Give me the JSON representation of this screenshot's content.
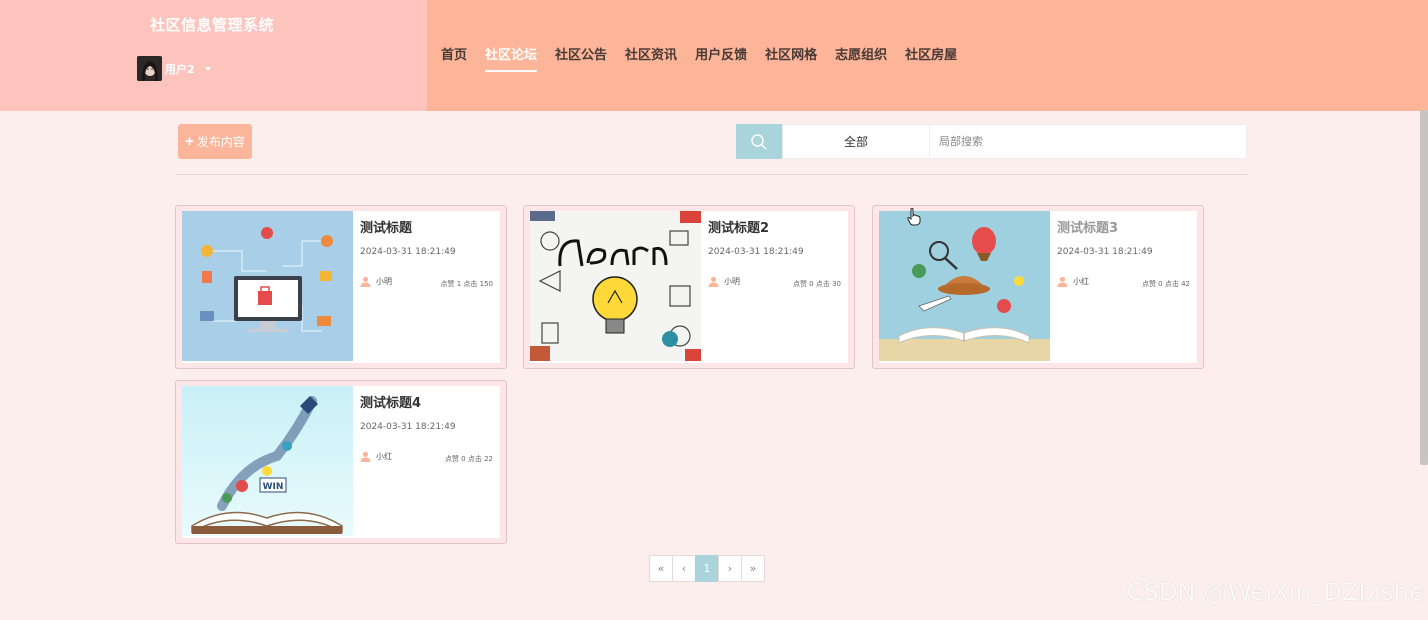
{
  "app": {
    "title": "社区信息管理系统"
  },
  "user": {
    "name": "用户2"
  },
  "nav": {
    "items": [
      {
        "label": "首页",
        "active": false
      },
      {
        "label": "社区论坛",
        "active": true
      },
      {
        "label": "社区公告",
        "active": false
      },
      {
        "label": "社区资讯",
        "active": false
      },
      {
        "label": "用户反馈",
        "active": false
      },
      {
        "label": "社区网格",
        "active": false
      },
      {
        "label": "志愿组织",
        "active": false
      },
      {
        "label": "社区房屋",
        "active": false
      }
    ]
  },
  "toolbar": {
    "publish_label": "发布内容",
    "search_scope": "全部",
    "search_placeholder": "局部搜索"
  },
  "posts": [
    {
      "title": "测试标题",
      "date": "2024-03-31 18:21:49",
      "author": "小明",
      "stats": "点赞 1 点击 150",
      "image": "online-shopping-illustration"
    },
    {
      "title": "测试标题2",
      "date": "2024-03-31 18:21:49",
      "author": "小明",
      "stats": "点赞 0 点击 30",
      "image": "learn-lightbulb-illustration"
    },
    {
      "title": "测试标题3",
      "date": "2024-03-31 18:21:49",
      "author": "小红",
      "stats": "点赞 0 点击 42",
      "image": "open-book-travel-illustration"
    },
    {
      "title": "测试标题4",
      "date": "2024-03-31 18:21:49",
      "author": "小红",
      "stats": "点赞 0 点击 22",
      "image": "book-rocket-win-illustration"
    }
  ],
  "pagination": {
    "first": "«",
    "prev": "‹",
    "current": "1",
    "next": "›",
    "last": "»"
  },
  "watermark": "CSDN @WeiXin_DZbishe",
  "colors": {
    "brand_bg": "#fcc4bc",
    "nav_bg": "#fcb598",
    "page_bg": "#fdeeee",
    "accent_teal": "#a9d4dc",
    "accent_peach": "#fbb59b"
  }
}
